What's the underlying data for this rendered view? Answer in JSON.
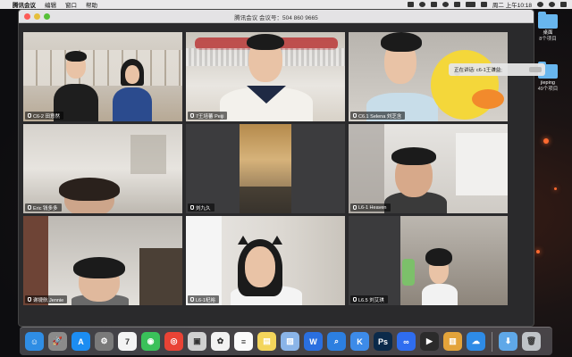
{
  "menubar": {
    "app_name": "腾讯会议",
    "menus": [
      "编辑",
      "窗口",
      "帮助"
    ],
    "clock": "周二 上午10:18"
  },
  "window": {
    "title": "腾讯会议 会议号：504 860 9665"
  },
  "speaking_tooltip": "正在讲话: c6-1王谦益;",
  "participants": [
    {
      "name": "C6-2 田意然"
    },
    {
      "name": "7王培蕃 Peiji"
    },
    {
      "name": "C6.1 Selena 刘芝含"
    },
    {
      "name": "Eric 钱多多"
    },
    {
      "name": "刘九久"
    },
    {
      "name": "L6-1 Heaven"
    },
    {
      "name": "谢捷航 Jennie"
    },
    {
      "name": "L6-1杞裕"
    },
    {
      "name": "L6.5 刘艾琪"
    }
  ],
  "desktop_icons": [
    {
      "label": "桌面",
      "sub": "8个项目"
    },
    {
      "label": "jieping",
      "sub": "49个项目"
    }
  ],
  "dock_apps": [
    {
      "icon": "finder-icon",
      "glyph": "☺",
      "color": "#2f8de4"
    },
    {
      "icon": "launchpad-icon",
      "glyph": "🚀",
      "color": "#8b8b8b"
    },
    {
      "icon": "app-store-icon",
      "glyph": "A",
      "color": "#1c8df2"
    },
    {
      "icon": "system-preferences-icon",
      "glyph": "⚙",
      "color": "#7a7a7a"
    },
    {
      "icon": "calendar-icon",
      "glyph": "7",
      "color": "#f4f4f4"
    },
    {
      "icon": "wechat-icon",
      "glyph": "◉",
      "color": "#3ac15a"
    },
    {
      "icon": "chrome-icon",
      "glyph": "◎",
      "color": "#e94335"
    },
    {
      "icon": "screenshot-icon",
      "glyph": "▣",
      "color": "#d0d0d0"
    },
    {
      "icon": "photos-icon",
      "glyph": "✿",
      "color": "#f2f2f2"
    },
    {
      "icon": "notes-icon",
      "glyph": "≡",
      "color": "#fbfbfb"
    },
    {
      "icon": "stickies-icon",
      "glyph": "▤",
      "color": "#f3d55b"
    },
    {
      "icon": "preview-icon",
      "glyph": "▨",
      "color": "#8ab4e8"
    },
    {
      "icon": "wps-icon",
      "glyph": "W",
      "color": "#2a6fe0"
    },
    {
      "icon": "search-icon",
      "glyph": "⌕",
      "color": "#2c7fe0"
    },
    {
      "icon": "keynote-icon",
      "glyph": "K",
      "color": "#3d8be8"
    },
    {
      "icon": "photoshop-icon",
      "glyph": "Ps",
      "color": "#0b2a4a"
    },
    {
      "icon": "tencent-meeting-icon",
      "glyph": "∞",
      "color": "#2f6df0"
    },
    {
      "icon": "final-cut-icon",
      "glyph": "▶",
      "color": "#2b2b2b"
    },
    {
      "icon": "archive-icon",
      "glyph": "▥",
      "color": "#e3a33a"
    },
    {
      "icon": "baidu-netdisk-icon",
      "glyph": "☁",
      "color": "#2e8be6"
    },
    {
      "icon": "downloads-folder-icon",
      "glyph": "⬇",
      "color": "#5fa8e8"
    },
    {
      "icon": "trash-icon",
      "glyph": "🗑",
      "color": "#bfc3c7"
    }
  ]
}
